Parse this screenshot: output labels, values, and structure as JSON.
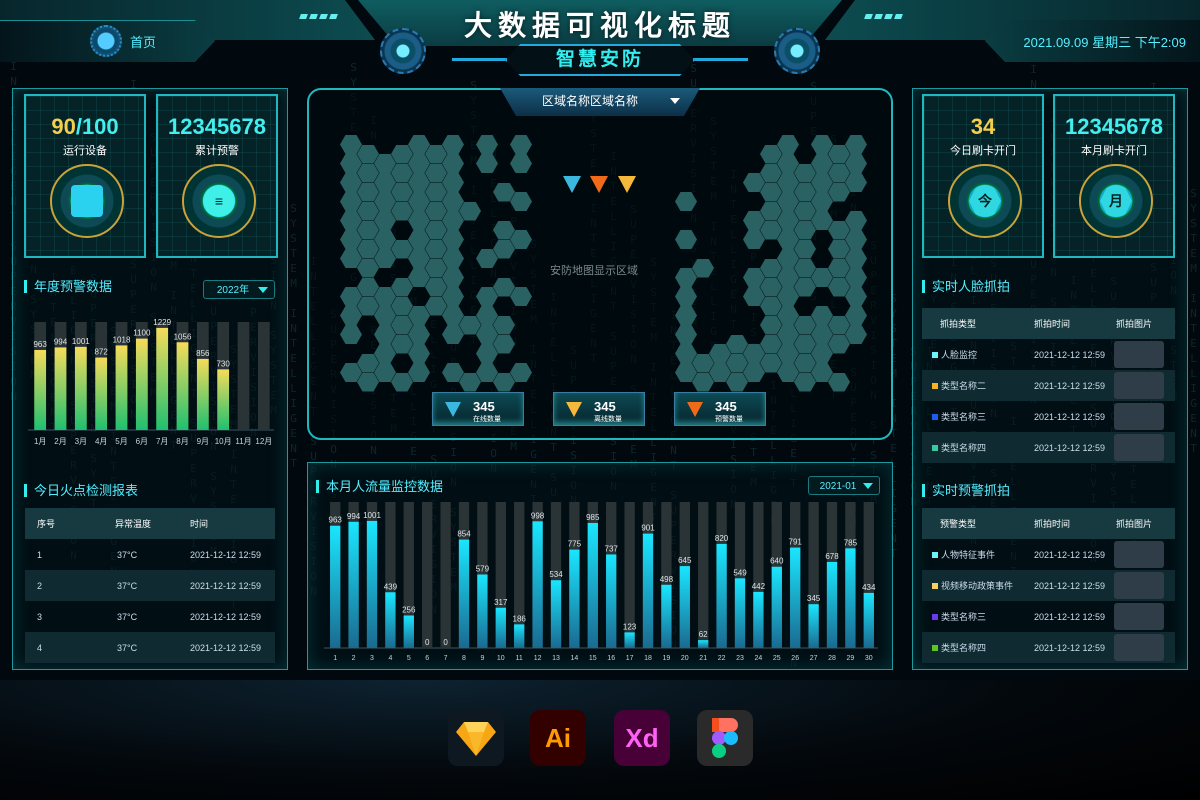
{
  "header": {
    "title": "大数据可视化标题",
    "subtitle": "智慧安防",
    "home_label": "首页",
    "datetime": "2021.09.09 星期三 下午2:09"
  },
  "stat_cards": [
    {
      "value_highlight": "90",
      "value_rest": "/100",
      "label": "运行设备",
      "icon": "cube-icon"
    },
    {
      "value_highlight": "",
      "value_rest": "12345678",
      "label": "累计预警",
      "icon": "lamp-icon"
    },
    {
      "value_highlight": "34",
      "value_rest": "",
      "label": "今日刷卡开门",
      "icon": "today-badge-icon",
      "glyph": "今"
    },
    {
      "value_highlight": "",
      "value_rest": "12345678",
      "label": "本月刷卡开门",
      "icon": "month-badge-icon",
      "glyph": "月"
    }
  ],
  "annual_warning": {
    "title": "年度预警数据",
    "year_select": "2022年"
  },
  "fire_report": {
    "title": "今日火点检测报表",
    "columns": [
      "序号",
      "异常温度",
      "时间"
    ],
    "rows": [
      [
        "1",
        "37°C",
        "2021-12-12 12:59"
      ],
      [
        "2",
        "37°C",
        "2021-12-12 12:59"
      ],
      [
        "3",
        "37°C",
        "2021-12-12 12:59"
      ],
      [
        "4",
        "37°C",
        "2021-12-12 12:59"
      ]
    ]
  },
  "map": {
    "region_select": "区域名称区域名称",
    "placeholder": "安防地图显示区域",
    "counters": [
      {
        "value": "345",
        "label": "在线数量",
        "color": "#3ab8e0"
      },
      {
        "value": "345",
        "label": "离线数量",
        "color": "#f5b83a"
      },
      {
        "value": "345",
        "label": "预警数量",
        "color": "#f06a1a"
      }
    ],
    "marker_colors": [
      "#3ab8e0",
      "#f06a1a",
      "#f5b83a"
    ]
  },
  "monthly_flow": {
    "title": "本月人流量监控数据",
    "month_select": "2021-01"
  },
  "face_capture": {
    "title": "实时人脸抓拍",
    "columns": [
      "抓拍类型",
      "抓拍时间",
      "抓拍图片"
    ],
    "rows": [
      {
        "type": "人脸监控",
        "color": "#6ef0f5",
        "time": "2021-12-12 12:59"
      },
      {
        "type": "类型名称二",
        "color": "#f5b320",
        "time": "2021-12-12 12:59"
      },
      {
        "type": "类型名称三",
        "color": "#1a5ef0",
        "time": "2021-12-12 12:59"
      },
      {
        "type": "类型名称四",
        "color": "#3ac8a0",
        "time": "2021-12-12 12:59"
      }
    ]
  },
  "warning_capture": {
    "title": "实时预警抓拍",
    "columns": [
      "预警类型",
      "抓拍时间",
      "抓拍图片"
    ],
    "rows": [
      {
        "type": "人物特征事件",
        "color": "#6ef0f5",
        "time": "2021-12-12 12:59"
      },
      {
        "type": "视频移动政策事件",
        "color": "#f5d060",
        "time": "2021-12-12 12:59"
      },
      {
        "type": "类型名称三",
        "color": "#6a3af0",
        "time": "2021-12-12 12:59"
      },
      {
        "type": "类型名称四",
        "color": "#5ac820",
        "time": "2021-12-12 12:59"
      }
    ]
  },
  "tools": [
    {
      "name": "sketch-icon",
      "label": ""
    },
    {
      "name": "illustrator-icon",
      "label": "Ai"
    },
    {
      "name": "xd-icon",
      "label": "Xd"
    },
    {
      "name": "figma-icon",
      "label": ""
    }
  ],
  "chart_data": [
    {
      "type": "bar",
      "title": "年度预警数据",
      "categories": [
        "1月",
        "2月",
        "3月",
        "4月",
        "5月",
        "6月",
        "7月",
        "8月",
        "9月",
        "10月",
        "11月",
        "12月"
      ],
      "values": [
        963,
        994,
        1001,
        872,
        1018,
        1100,
        1229,
        1056,
        856,
        730,
        null,
        null
      ],
      "ylim": [
        0,
        1300
      ],
      "xlabel": "",
      "ylabel": "",
      "grid": false
    },
    {
      "type": "bar",
      "title": "本月人流量监控数据",
      "categories": [
        "1",
        "2",
        "3",
        "4",
        "5",
        "6",
        "7",
        "8",
        "9",
        "10",
        "11",
        "12",
        "13",
        "14",
        "15",
        "16",
        "17",
        "18",
        "19",
        "20",
        "21",
        "22",
        "23",
        "24",
        "25",
        "26",
        "27",
        "28",
        "29",
        "30"
      ],
      "values": [
        963,
        994,
        1001,
        439,
        256,
        0,
        0,
        854,
        579,
        317,
        186,
        998,
        534,
        775,
        985,
        737,
        123,
        901,
        498,
        645,
        62,
        820,
        549,
        442,
        640,
        791,
        345,
        678,
        785,
        434
      ],
      "ylim": [
        0,
        1150
      ],
      "xlabel": "",
      "ylabel": "",
      "grid": false
    }
  ]
}
